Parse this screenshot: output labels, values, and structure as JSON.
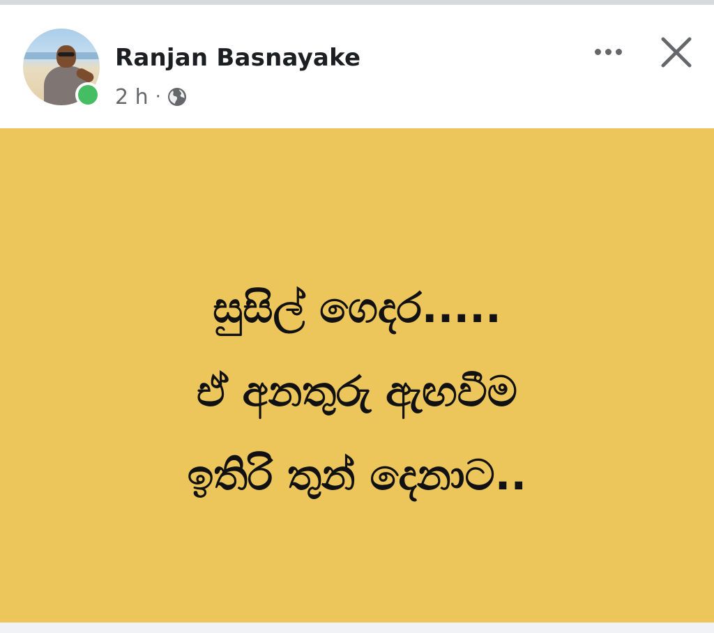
{
  "post": {
    "author_name": "Ranjan Basnayake",
    "time_ago": "2 h",
    "separator": "·",
    "audience_icon": "globe-icon",
    "online_status_color": "#45bd62",
    "background_color": "#ecc55b",
    "text_lines": [
      "සුසිල් ගෙදර.....",
      "ඒ අනතුරු ඇඟවීම",
      "ඉතිරි තුන් දෙනාට.."
    ]
  },
  "header": {
    "more_icon": "more-options-icon",
    "close_icon": "close-icon"
  }
}
